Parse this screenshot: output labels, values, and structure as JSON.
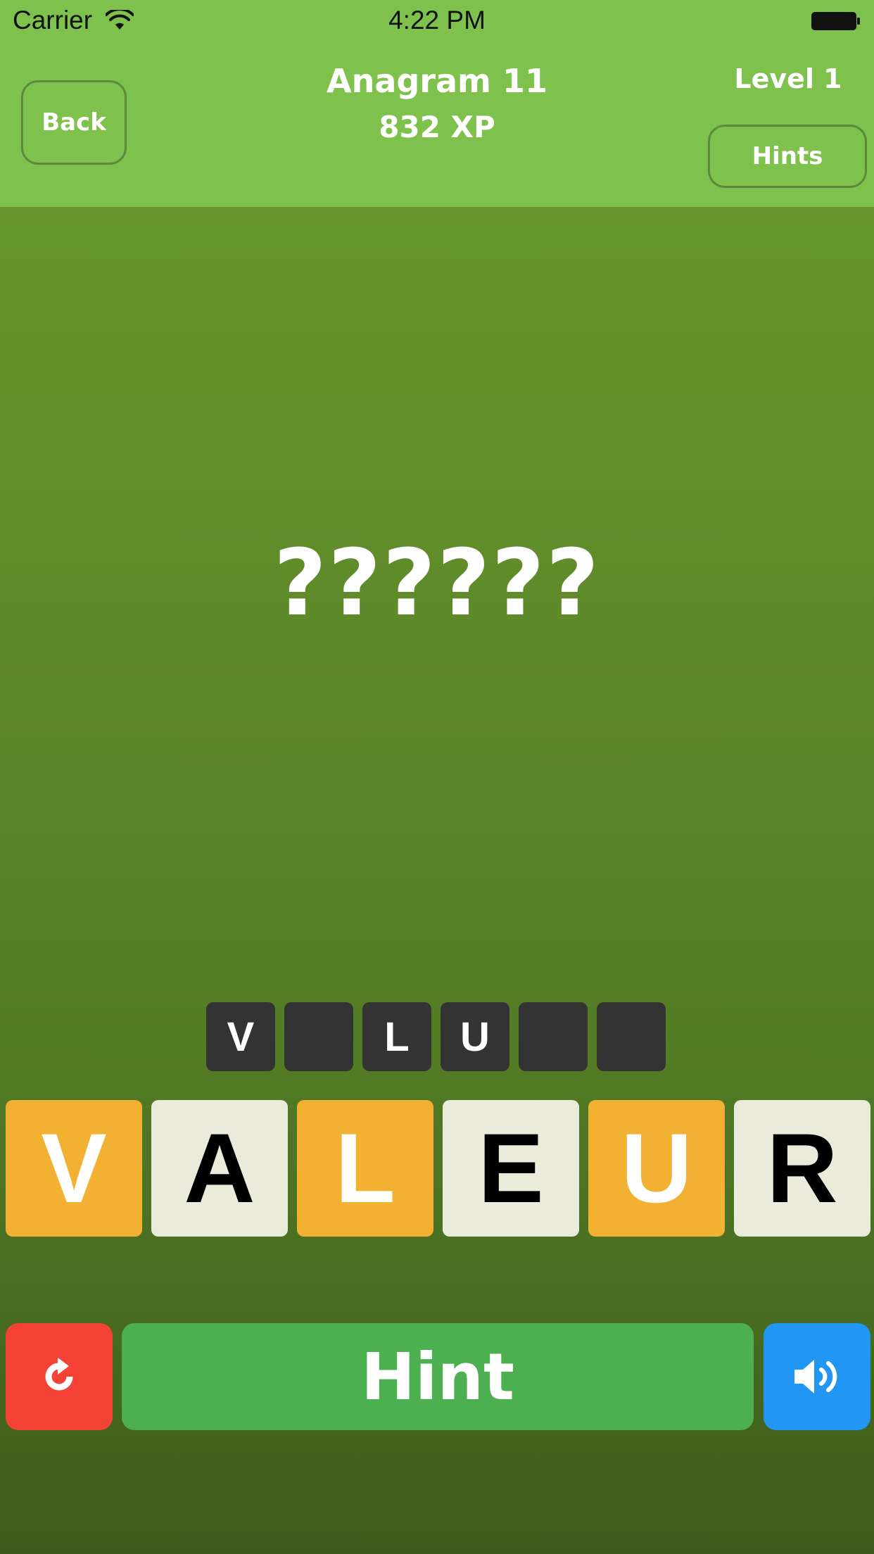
{
  "status_bar": {
    "carrier": "Carrier",
    "time": "4:22 PM"
  },
  "header": {
    "back_label": "Back",
    "title": "Anagram 11",
    "xp": "832 XP",
    "level": "Level 1",
    "hints_label": "Hints"
  },
  "puzzle": {
    "mask": "??????"
  },
  "answer_slots": [
    "V",
    "",
    "L",
    "U",
    "",
    ""
  ],
  "tiles": [
    {
      "letter": "V",
      "state": "used"
    },
    {
      "letter": "A",
      "state": "free"
    },
    {
      "letter": "L",
      "state": "used"
    },
    {
      "letter": "E",
      "state": "free"
    },
    {
      "letter": "U",
      "state": "used"
    },
    {
      "letter": "R",
      "state": "free"
    }
  ],
  "controls": {
    "hint_label": "Hint",
    "reset_icon": "refresh-icon",
    "sound_icon": "speaker-icon"
  },
  "colors": {
    "header_bg": "#7fc14d",
    "tile_used": "#f2b133",
    "tile_free": "#ebebdb",
    "slot_bg": "#333333",
    "reset_bg": "#f44336",
    "hint_bg": "#4caf50",
    "sound_bg": "#2196f3"
  }
}
